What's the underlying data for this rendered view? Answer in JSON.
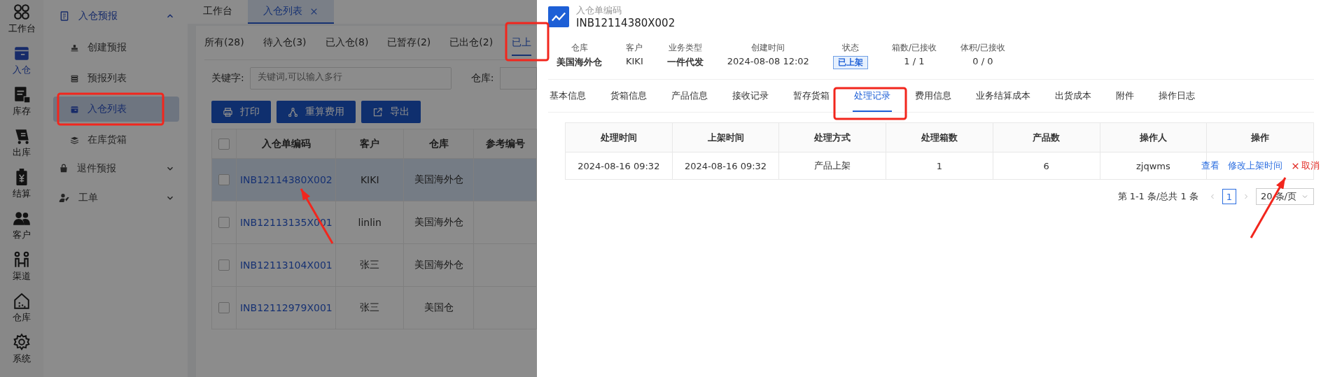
{
  "rail": [
    {
      "label": "工作台",
      "selected": false
    },
    {
      "label": "入仓",
      "selected": true
    },
    {
      "label": "库存",
      "selected": false
    },
    {
      "label": "出库",
      "selected": false
    },
    {
      "label": "结算",
      "selected": false
    },
    {
      "label": "客户",
      "selected": false
    },
    {
      "label": "渠道",
      "selected": false
    },
    {
      "label": "仓库",
      "selected": false
    },
    {
      "label": "系统",
      "selected": false
    }
  ],
  "menu": [
    {
      "label": "入仓预报",
      "expanded": true,
      "children": [
        {
          "label": "创建预报",
          "selected": false
        },
        {
          "label": "预报列表",
          "selected": false
        },
        {
          "label": "入仓列表",
          "selected": true
        },
        {
          "label": "在库货箱",
          "selected": false
        }
      ]
    },
    {
      "label": "退件预报",
      "expanded": false
    },
    {
      "label": "工单",
      "expanded": false
    }
  ],
  "page_tabs": [
    {
      "label": "工作台",
      "selected": false,
      "closable": false
    },
    {
      "label": "入仓列表",
      "selected": true,
      "closable": true
    }
  ],
  "status_tabs": [
    {
      "label": "所有(28)",
      "selected": false
    },
    {
      "label": "待入仓(3)",
      "selected": false
    },
    {
      "label": "已入仓(8)",
      "selected": false
    },
    {
      "label": "已暂存(2)",
      "selected": false
    },
    {
      "label": "已出仓(2)",
      "selected": false
    },
    {
      "label": "已上",
      "selected": true
    }
  ],
  "filters": [
    {
      "label": "关键字:",
      "placeholder": "关键词,可以输入多行"
    },
    {
      "label": "仓库:"
    }
  ],
  "actions": [
    {
      "label": "打印",
      "kind": "print"
    },
    {
      "label": "重算费用",
      "kind": "recalc"
    },
    {
      "label": "导出",
      "kind": "export"
    }
  ],
  "table": {
    "header_checked": false,
    "columns": [
      "入仓单编码",
      "客户",
      "仓库",
      "参考编号"
    ],
    "rows": [
      {
        "selected": true,
        "checked": false,
        "cells": [
          "INB12114380X002",
          "KIKI",
          "美国海外仓"
        ]
      },
      {
        "selected": false,
        "checked": false,
        "cells": [
          "INB12113135X001",
          "linlin",
          "美国海外仓"
        ]
      },
      {
        "selected": false,
        "checked": false,
        "cells": [
          "INB12113104X001",
          "张三",
          "美国海外仓"
        ]
      },
      {
        "selected": false,
        "checked": false,
        "cells": [
          "INB12112979X001",
          "张三",
          "美国仓"
        ]
      }
    ]
  },
  "drawer": {
    "label": "入仓单编码",
    "code": "INB12114380X002",
    "fields": [
      {
        "label": "仓库",
        "value": "美国海外仓",
        "kind": "bold"
      },
      {
        "label": "客户",
        "value": "KIKI",
        "kind": "plain"
      },
      {
        "label": "业务类型",
        "value": "一件代发",
        "kind": "bold"
      },
      {
        "label": "创建时间",
        "value": "2024-08-08 12:02",
        "kind": "plain"
      },
      {
        "label": "状态",
        "value": "已上架",
        "kind": "tag"
      },
      {
        "label": "箱数/已接收",
        "value": "1 / 1",
        "kind": "plain"
      },
      {
        "label": "体积/已接收",
        "value": "0 / 0",
        "kind": "plain"
      }
    ],
    "tabs": [
      {
        "label": "基本信息",
        "selected": false
      },
      {
        "label": "货箱信息",
        "selected": false
      },
      {
        "label": "产品信息",
        "selected": false
      },
      {
        "label": "接收记录",
        "selected": false
      },
      {
        "label": "暂存货箱",
        "selected": false
      },
      {
        "label": "处理记录",
        "selected": true
      },
      {
        "label": "费用信息",
        "selected": false
      },
      {
        "label": "业务结算成本",
        "selected": false
      },
      {
        "label": "出货成本",
        "selected": false
      },
      {
        "label": "附件",
        "selected": false
      },
      {
        "label": "操作日志",
        "selected": false
      }
    ],
    "table": {
      "columns": [
        "处理时间",
        "上架时间",
        "处理方式",
        "处理箱数",
        "产品数",
        "操作人",
        "操作"
      ],
      "rows": [
        {
          "cells": [
            "2024-08-16 09:32",
            "2024-08-16 09:32",
            "产品上架",
            "1",
            "6",
            "zjqwms"
          ],
          "actions": [
            {
              "label": "查看",
              "kind": "link"
            },
            {
              "label": "修改上架时间",
              "kind": "link"
            },
            {
              "label": "取消",
              "kind": "danger"
            }
          ]
        }
      ]
    },
    "pagination": {
      "summary": "第 1-1 条/总共 1 条",
      "pages": [
        {
          "label": "1",
          "selected": true
        }
      ],
      "page_size": "20 条/页"
    }
  }
}
